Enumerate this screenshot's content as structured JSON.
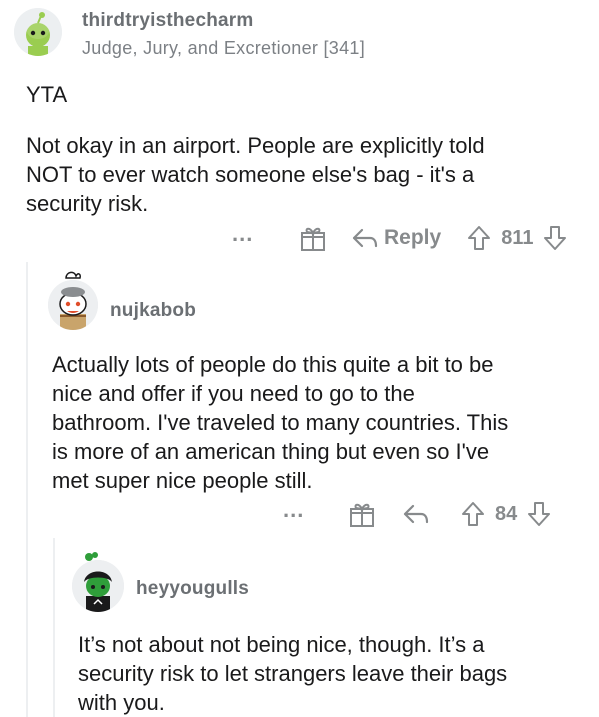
{
  "comments": [
    {
      "username": "thirdtryisthecharm",
      "flair": "Judge, Jury, and Excretioner [341]",
      "verdict": "YTA",
      "body": "Not okay in an airport. People are explicitly told\nNOT to ever watch someone else's bag - it's a\nsecurity risk.",
      "actions": {
        "more": "...",
        "award_icon": "gift-icon",
        "reply_icon": "reply-arrow-icon",
        "reply_label": "Reply",
        "upvote_icon": "upvote-arrow-icon",
        "score": "811",
        "downvote_icon": "downvote-arrow-icon"
      }
    },
    {
      "username": "nujkabob",
      "body": "Actually lots of people do this quite a bit to be\nnice and offer if you need to go to the\nbathroom. I've traveled to many countries. This\nis more of an american thing but even so I've\nmet super nice people still.",
      "actions": {
        "more": "...",
        "award_icon": "gift-icon",
        "reply_icon": "reply-arrow-icon",
        "upvote_icon": "upvote-arrow-icon",
        "score": "84",
        "downvote_icon": "downvote-arrow-icon"
      }
    },
    {
      "username": "heyyougulls",
      "body": "It’s not about not being nice, though. It’s a\nsecurity risk to let strangers leave their bags\nwith you."
    }
  ],
  "colors": {
    "meta_text": "#878a8c",
    "body_text": "#1a1a1b",
    "thread_line": "#edeff1"
  }
}
